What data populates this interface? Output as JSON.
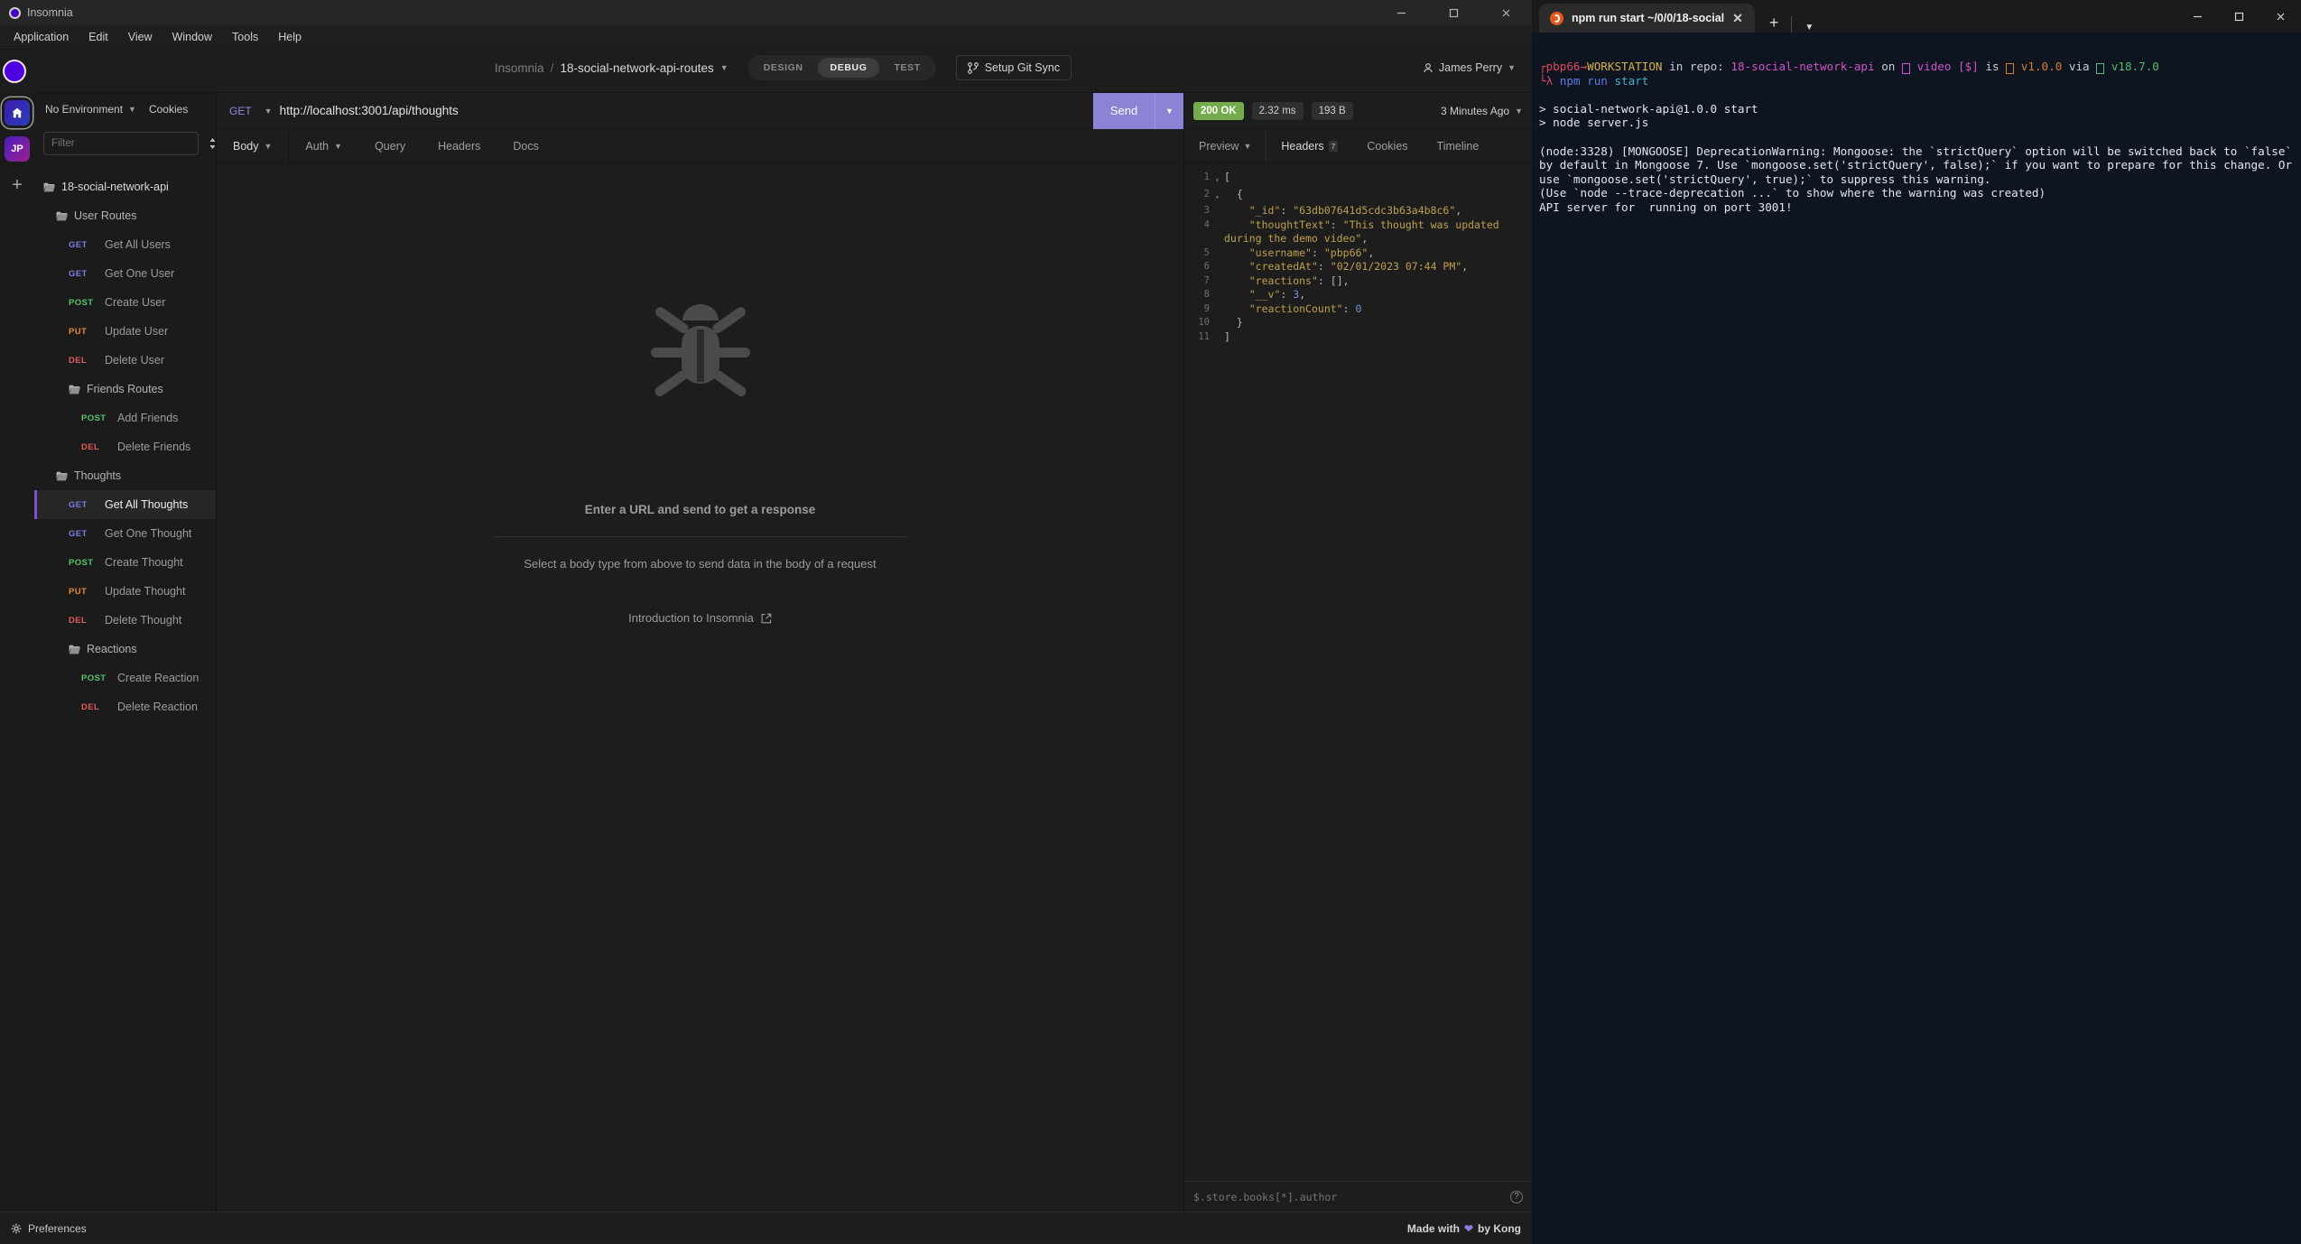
{
  "insomnia": {
    "window_title": "Insomnia",
    "menu": [
      "Application",
      "Edit",
      "View",
      "Window",
      "Help"
    ],
    "menu_full": [
      "Application",
      "Edit",
      "View",
      "Window",
      "Tools",
      "Help"
    ],
    "project": {
      "workspace": "Insomnia",
      "separator": "/",
      "name": "18-social-network-api-routes",
      "activity_tabs": [
        "DESIGN",
        "DEBUG",
        "TEST"
      ],
      "active_activity": "DEBUG",
      "git_sync_label": "Setup Git Sync",
      "account_name": "James Perry"
    },
    "sidebar": {
      "environment_label": "No Environment",
      "cookies_label": "Cookies",
      "filter_placeholder": "Filter",
      "tree": [
        {
          "type": "root",
          "indent": 0,
          "label": "18-social-network-api"
        },
        {
          "type": "folder",
          "indent": 1,
          "label": "User Routes"
        },
        {
          "type": "request",
          "indent": 2,
          "method": "GET",
          "label": "Get All Users"
        },
        {
          "type": "request",
          "indent": 2,
          "method": "GET",
          "label": "Get One User"
        },
        {
          "type": "request",
          "indent": 2,
          "method": "POST",
          "label": "Create User"
        },
        {
          "type": "request",
          "indent": 2,
          "method": "PUT",
          "label": "Update User"
        },
        {
          "type": "request",
          "indent": 2,
          "method": "DEL",
          "label": "Delete User"
        },
        {
          "type": "folder",
          "indent": 2,
          "label": "Friends Routes"
        },
        {
          "type": "request",
          "indent": 3,
          "method": "POST",
          "label": "Add Friends"
        },
        {
          "type": "request",
          "indent": 3,
          "method": "DEL",
          "label": "Delete Friends"
        },
        {
          "type": "folder",
          "indent": 1,
          "label": "Thoughts"
        },
        {
          "type": "request",
          "indent": 2,
          "method": "GET",
          "label": "Get All Thoughts",
          "selected": true
        },
        {
          "type": "request",
          "indent": 2,
          "method": "GET",
          "label": "Get One Thought"
        },
        {
          "type": "request",
          "indent": 2,
          "method": "POST",
          "label": "Create Thought"
        },
        {
          "type": "request",
          "indent": 2,
          "method": "PUT",
          "label": "Update Thought"
        },
        {
          "type": "request",
          "indent": 2,
          "method": "DEL",
          "label": "Delete Thought"
        },
        {
          "type": "folder",
          "indent": 2,
          "label": "Reactions"
        },
        {
          "type": "request",
          "indent": 3,
          "method": "POST",
          "label": "Create Reaction"
        },
        {
          "type": "request",
          "indent": 3,
          "method": "DEL",
          "label": "Delete Reaction"
        }
      ]
    },
    "request": {
      "method": "GET",
      "url": "http://localhost:3001/api/thoughts",
      "send_label": "Send",
      "tabs": [
        "Body",
        "Auth",
        "Query",
        "Headers",
        "Docs"
      ],
      "active_tab": "Body",
      "empty_heading": "Enter a URL and send to get a response",
      "empty_sub": "Select a body type from above to send data in the body of a request",
      "empty_link": "Introduction to Insomnia"
    },
    "response": {
      "status_code": "200",
      "status_text": "OK",
      "elapsed": "2.32 ms",
      "size": "193 B",
      "history_label": "3 Minutes Ago",
      "tabs": [
        "Preview",
        "Headers",
        "Cookies",
        "Timeline"
      ],
      "active_tab": "Headers",
      "headers_count": "7",
      "filter_placeholder": "$.store.books[*].author",
      "body_lines": [
        {
          "n": "1",
          "fold": "▾",
          "code": "["
        },
        {
          "n": "2",
          "fold": "▾",
          "code": "  {"
        },
        {
          "n": "3",
          "fold": "",
          "code": "    \"_id\": \"63db07641d5cdc3b63a4b8c6\","
        },
        {
          "n": "4",
          "fold": "",
          "code": "    \"thoughtText\": \"This thought was updated during the demo video\","
        },
        {
          "n": "5",
          "fold": "",
          "code": "    \"username\": \"pbp66\","
        },
        {
          "n": "6",
          "fold": "",
          "code": "    \"createdAt\": \"02/01/2023 07:44 PM\","
        },
        {
          "n": "7",
          "fold": "",
          "code": "    \"reactions\": [],"
        },
        {
          "n": "8",
          "fold": "",
          "code": "    \"__v\": 3,"
        },
        {
          "n": "9",
          "fold": "",
          "code": "    \"reactionCount\": 0"
        },
        {
          "n": "10",
          "fold": "",
          "code": "  }"
        },
        {
          "n": "11",
          "fold": "",
          "code": "]"
        }
      ]
    },
    "statusbar": {
      "preferences_label": "Preferences",
      "made_with_prefix": "Made with",
      "made_with_suffix": "by Kong"
    },
    "colors": {
      "accent": "#8b83d6",
      "status_ok": "#74ab4c",
      "get": "#7a7ce0",
      "post": "#59c36a",
      "put": "#e08a3c",
      "del": "#e05b5b"
    }
  },
  "terminal": {
    "tab_title": "npm run start ~/0/0/18-social",
    "prompt": {
      "user": "pbp66",
      "arrow": "→",
      "host": "WORKSTATION",
      "in_label": "in repo:",
      "repo": "18-social-network-api",
      "on_label": "on",
      "branch": "video",
      "dirty": "[$]",
      "is_label": "is",
      "pkg_version": "v1.0.0",
      "via_label": "via",
      "node_version": "v18.7.0",
      "lambda": "λ",
      "command_npm": "npm",
      "command_run": "run",
      "command_start": "start"
    },
    "output": [
      "> social-network-api@1.0.0 start",
      "> node server.js",
      "",
      "(node:3328) [MONGOOSE] DeprecationWarning: Mongoose: the `strictQuery` option will be switched back to `false` by default in Mongoose 7. Use `mongoose.set('strictQuery', false);` if you want to prepare for this change. Or use `mongoose.set('strictQuery', true);` to suppress this warning.",
      "(Use `node --trace-deprecation ...` to show where the warning was created)",
      "API server for  running on port 3001!"
    ]
  }
}
